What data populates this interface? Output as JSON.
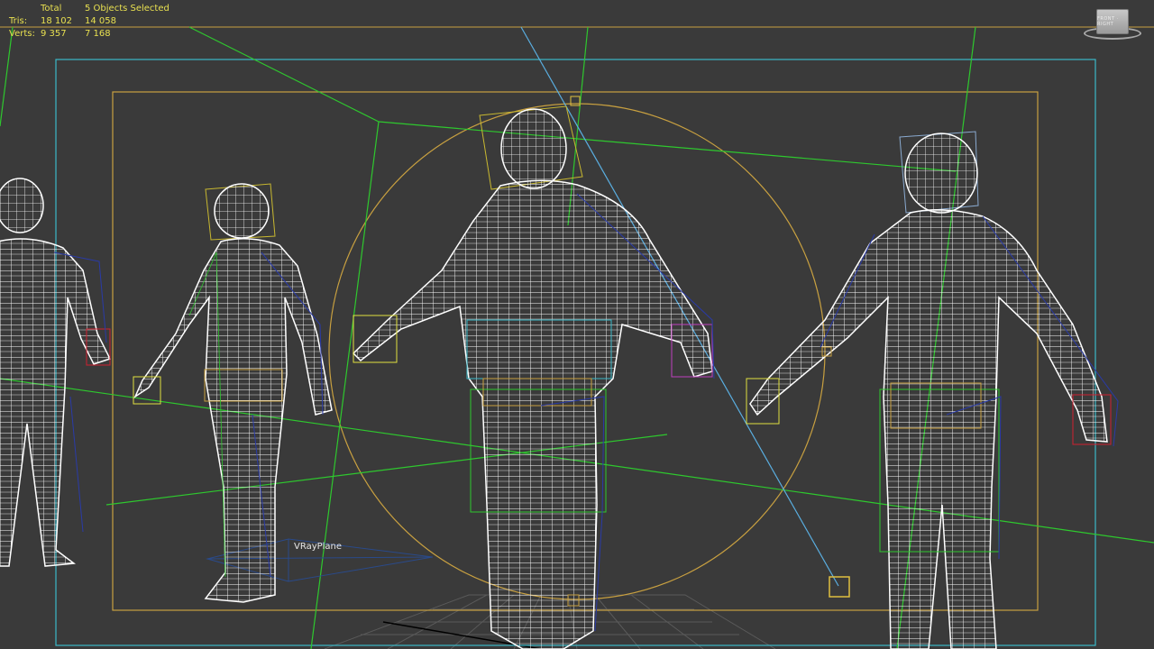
{
  "stats": {
    "header_total": "Total",
    "header_selected": "5 Objects Selected",
    "rows": [
      {
        "label": "Tris:",
        "total": "18 102",
        "selected": "14 058"
      },
      {
        "label": "Verts:",
        "total": "9 357",
        "selected": "7 168"
      }
    ]
  },
  "scene": {
    "vray_plane_label": "VRayPlane",
    "viewcube_label": "FRONT · RIGHT"
  },
  "colors": {
    "background": "#3a3a3a",
    "wire_white": "#ffffff",
    "green": "#2ec82e",
    "yellow": "#c8a040",
    "cyan": "#3ab8c8",
    "blue": "#2a3aa8",
    "stats_text": "#e8e050"
  }
}
